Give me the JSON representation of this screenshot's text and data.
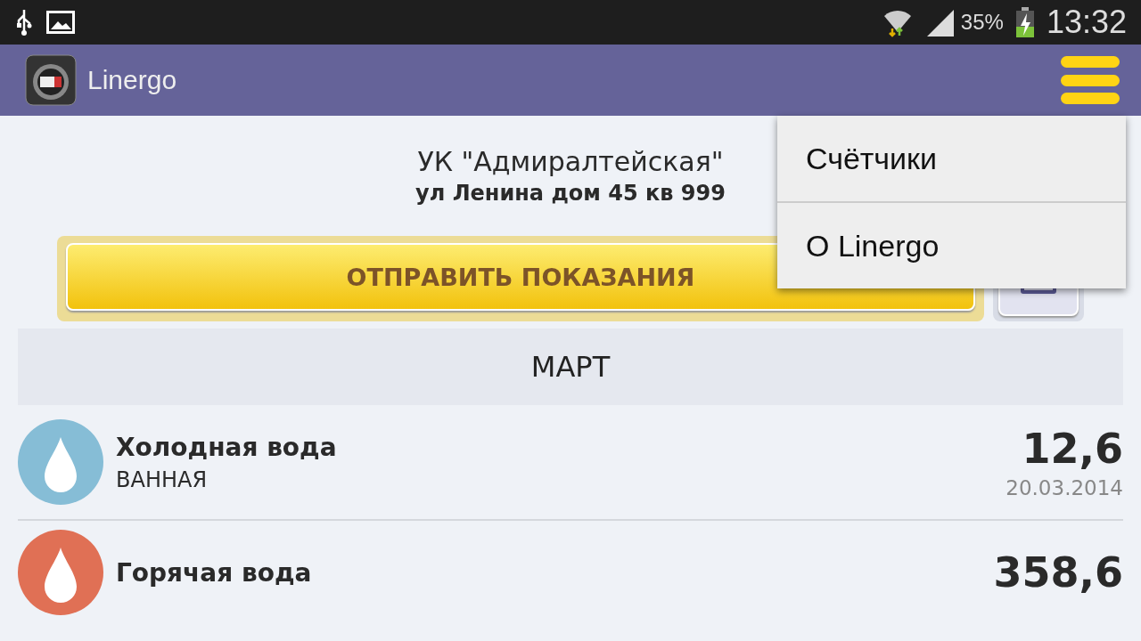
{
  "status_bar": {
    "battery": "35%",
    "time": "13:32"
  },
  "app_bar": {
    "title": "Linergo"
  },
  "menu": {
    "items": [
      {
        "label": "Счётчики"
      },
      {
        "label": "О Linergo"
      }
    ]
  },
  "company": {
    "name": "УК \"Адмиралтейская\"",
    "address": "ул Ленина дом 45 кв 999"
  },
  "send_button": {
    "label": "ОТПРАВИТЬ ПОКАЗАНИЯ"
  },
  "month": "МАРТ",
  "meters": [
    {
      "name": "Холодная вода",
      "place": "ВАННАЯ",
      "value": "12,6",
      "date": "20.03.2014",
      "color": "#86bdd6"
    },
    {
      "name": "Горячая вода",
      "value": "358,6",
      "color": "#e07055"
    }
  ]
}
